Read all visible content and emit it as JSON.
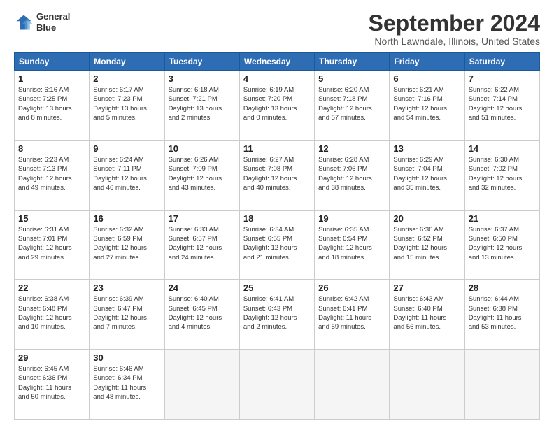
{
  "header": {
    "logo_line1": "General",
    "logo_line2": "Blue",
    "title": "September 2024",
    "location": "North Lawndale, Illinois, United States"
  },
  "days_of_week": [
    "Sunday",
    "Monday",
    "Tuesday",
    "Wednesday",
    "Thursday",
    "Friday",
    "Saturday"
  ],
  "weeks": [
    [
      {
        "day": "1",
        "info": "Sunrise: 6:16 AM\nSunset: 7:25 PM\nDaylight: 13 hours\nand 8 minutes."
      },
      {
        "day": "2",
        "info": "Sunrise: 6:17 AM\nSunset: 7:23 PM\nDaylight: 13 hours\nand 5 minutes."
      },
      {
        "day": "3",
        "info": "Sunrise: 6:18 AM\nSunset: 7:21 PM\nDaylight: 13 hours\nand 2 minutes."
      },
      {
        "day": "4",
        "info": "Sunrise: 6:19 AM\nSunset: 7:20 PM\nDaylight: 13 hours\nand 0 minutes."
      },
      {
        "day": "5",
        "info": "Sunrise: 6:20 AM\nSunset: 7:18 PM\nDaylight: 12 hours\nand 57 minutes."
      },
      {
        "day": "6",
        "info": "Sunrise: 6:21 AM\nSunset: 7:16 PM\nDaylight: 12 hours\nand 54 minutes."
      },
      {
        "day": "7",
        "info": "Sunrise: 6:22 AM\nSunset: 7:14 PM\nDaylight: 12 hours\nand 51 minutes."
      }
    ],
    [
      {
        "day": "8",
        "info": "Sunrise: 6:23 AM\nSunset: 7:13 PM\nDaylight: 12 hours\nand 49 minutes."
      },
      {
        "day": "9",
        "info": "Sunrise: 6:24 AM\nSunset: 7:11 PM\nDaylight: 12 hours\nand 46 minutes."
      },
      {
        "day": "10",
        "info": "Sunrise: 6:26 AM\nSunset: 7:09 PM\nDaylight: 12 hours\nand 43 minutes."
      },
      {
        "day": "11",
        "info": "Sunrise: 6:27 AM\nSunset: 7:08 PM\nDaylight: 12 hours\nand 40 minutes."
      },
      {
        "day": "12",
        "info": "Sunrise: 6:28 AM\nSunset: 7:06 PM\nDaylight: 12 hours\nand 38 minutes."
      },
      {
        "day": "13",
        "info": "Sunrise: 6:29 AM\nSunset: 7:04 PM\nDaylight: 12 hours\nand 35 minutes."
      },
      {
        "day": "14",
        "info": "Sunrise: 6:30 AM\nSunset: 7:02 PM\nDaylight: 12 hours\nand 32 minutes."
      }
    ],
    [
      {
        "day": "15",
        "info": "Sunrise: 6:31 AM\nSunset: 7:01 PM\nDaylight: 12 hours\nand 29 minutes."
      },
      {
        "day": "16",
        "info": "Sunrise: 6:32 AM\nSunset: 6:59 PM\nDaylight: 12 hours\nand 27 minutes."
      },
      {
        "day": "17",
        "info": "Sunrise: 6:33 AM\nSunset: 6:57 PM\nDaylight: 12 hours\nand 24 minutes."
      },
      {
        "day": "18",
        "info": "Sunrise: 6:34 AM\nSunset: 6:55 PM\nDaylight: 12 hours\nand 21 minutes."
      },
      {
        "day": "19",
        "info": "Sunrise: 6:35 AM\nSunset: 6:54 PM\nDaylight: 12 hours\nand 18 minutes."
      },
      {
        "day": "20",
        "info": "Sunrise: 6:36 AM\nSunset: 6:52 PM\nDaylight: 12 hours\nand 15 minutes."
      },
      {
        "day": "21",
        "info": "Sunrise: 6:37 AM\nSunset: 6:50 PM\nDaylight: 12 hours\nand 13 minutes."
      }
    ],
    [
      {
        "day": "22",
        "info": "Sunrise: 6:38 AM\nSunset: 6:48 PM\nDaylight: 12 hours\nand 10 minutes."
      },
      {
        "day": "23",
        "info": "Sunrise: 6:39 AM\nSunset: 6:47 PM\nDaylight: 12 hours\nand 7 minutes."
      },
      {
        "day": "24",
        "info": "Sunrise: 6:40 AM\nSunset: 6:45 PM\nDaylight: 12 hours\nand 4 minutes."
      },
      {
        "day": "25",
        "info": "Sunrise: 6:41 AM\nSunset: 6:43 PM\nDaylight: 12 hours\nand 2 minutes."
      },
      {
        "day": "26",
        "info": "Sunrise: 6:42 AM\nSunset: 6:41 PM\nDaylight: 11 hours\nand 59 minutes."
      },
      {
        "day": "27",
        "info": "Sunrise: 6:43 AM\nSunset: 6:40 PM\nDaylight: 11 hours\nand 56 minutes."
      },
      {
        "day": "28",
        "info": "Sunrise: 6:44 AM\nSunset: 6:38 PM\nDaylight: 11 hours\nand 53 minutes."
      }
    ],
    [
      {
        "day": "29",
        "info": "Sunrise: 6:45 AM\nSunset: 6:36 PM\nDaylight: 11 hours\nand 50 minutes."
      },
      {
        "day": "30",
        "info": "Sunrise: 6:46 AM\nSunset: 6:34 PM\nDaylight: 11 hours\nand 48 minutes."
      },
      {
        "day": "",
        "info": ""
      },
      {
        "day": "",
        "info": ""
      },
      {
        "day": "",
        "info": ""
      },
      {
        "day": "",
        "info": ""
      },
      {
        "day": "",
        "info": ""
      }
    ]
  ]
}
